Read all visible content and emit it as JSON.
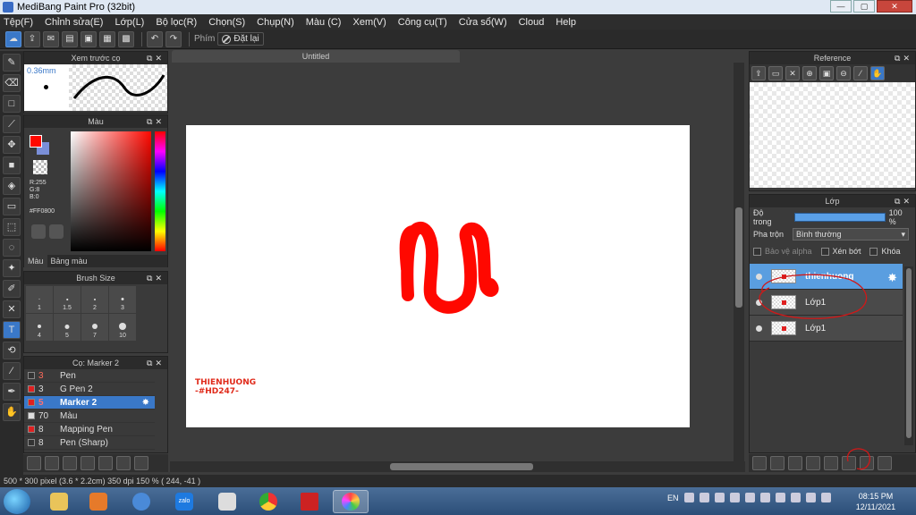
{
  "window": {
    "title": "MediBang Paint Pro (32bit)",
    "buttons": [
      "—",
      "▢",
      "✕"
    ]
  },
  "menu": [
    "Tệp(F)",
    "Chỉnh sửa(E)",
    "Lớp(L)",
    "Bộ lọc(R)",
    "Chọn(S)",
    "Chụp(N)",
    "Màu (C)",
    "Xem(V)",
    "Công cụ(T)",
    "Cửa sổ(W)",
    "Cloud",
    "Help"
  ],
  "toolbar": {
    "shortcut_label": "Phím",
    "reset_label": "Đặt lại"
  },
  "brush_preview": {
    "title": "Xem trước cọ",
    "size": "0.36mm"
  },
  "color_panel": {
    "title": "Màu",
    "r": "R:255",
    "g": "G:8",
    "b": "B:0",
    "hex": "#FF0800",
    "tabs": [
      "Màu",
      "Bảng màu"
    ],
    "fg_color": "#ff0800"
  },
  "brush_size": {
    "title": "Brush Size",
    "sizes": [
      "1",
      "1.5",
      "2",
      "3",
      "4",
      "5",
      "7",
      "10"
    ]
  },
  "brush_list": {
    "title": "Cọ: Marker 2",
    "items": [
      {
        "num": "3",
        "name": "Pen",
        "color": "#333333"
      },
      {
        "num": "3",
        "name": "G Pen 2",
        "color": "#e02020"
      },
      {
        "num": "5",
        "name": "Marker 2",
        "color": "#e02020",
        "selected": true
      },
      {
        "num": "70",
        "name": "Màu",
        "color": "#dddddd"
      },
      {
        "num": "8",
        "name": "Mapping Pen",
        "color": "#e02020"
      },
      {
        "num": "8",
        "name": "Pen (Sharp)",
        "color": "#333333"
      }
    ]
  },
  "canvas": {
    "tab_title": "Untitled",
    "signature_line1": "THIENHUONG",
    "signature_line2": "-#HD247-"
  },
  "reference": {
    "title": "Reference"
  },
  "layer_panel": {
    "title": "Lớp",
    "opacity_label": "Độ trong",
    "opacity_value": "100 %",
    "opacity_fraction": 1.0,
    "blend_label": "Pha trộn",
    "blend_value": "Bình thường",
    "protect_alpha": "Bảo vệ alpha",
    "clipping": "Xén bớt",
    "lock": "Khóa",
    "layers": [
      {
        "name": "thienhuong",
        "selected": true
      },
      {
        "name": "Lớp1"
      },
      {
        "name": "Lớp1"
      }
    ]
  },
  "status": {
    "text": "500 * 300 pixel   (3.6 * 2.2cm)   350 dpi   150 %   ( 244, -41 )"
  },
  "taskbar": {
    "lang": "EN",
    "time": "08:15 PM",
    "date": "12/11/2021",
    "apps": [
      "zalo"
    ]
  }
}
